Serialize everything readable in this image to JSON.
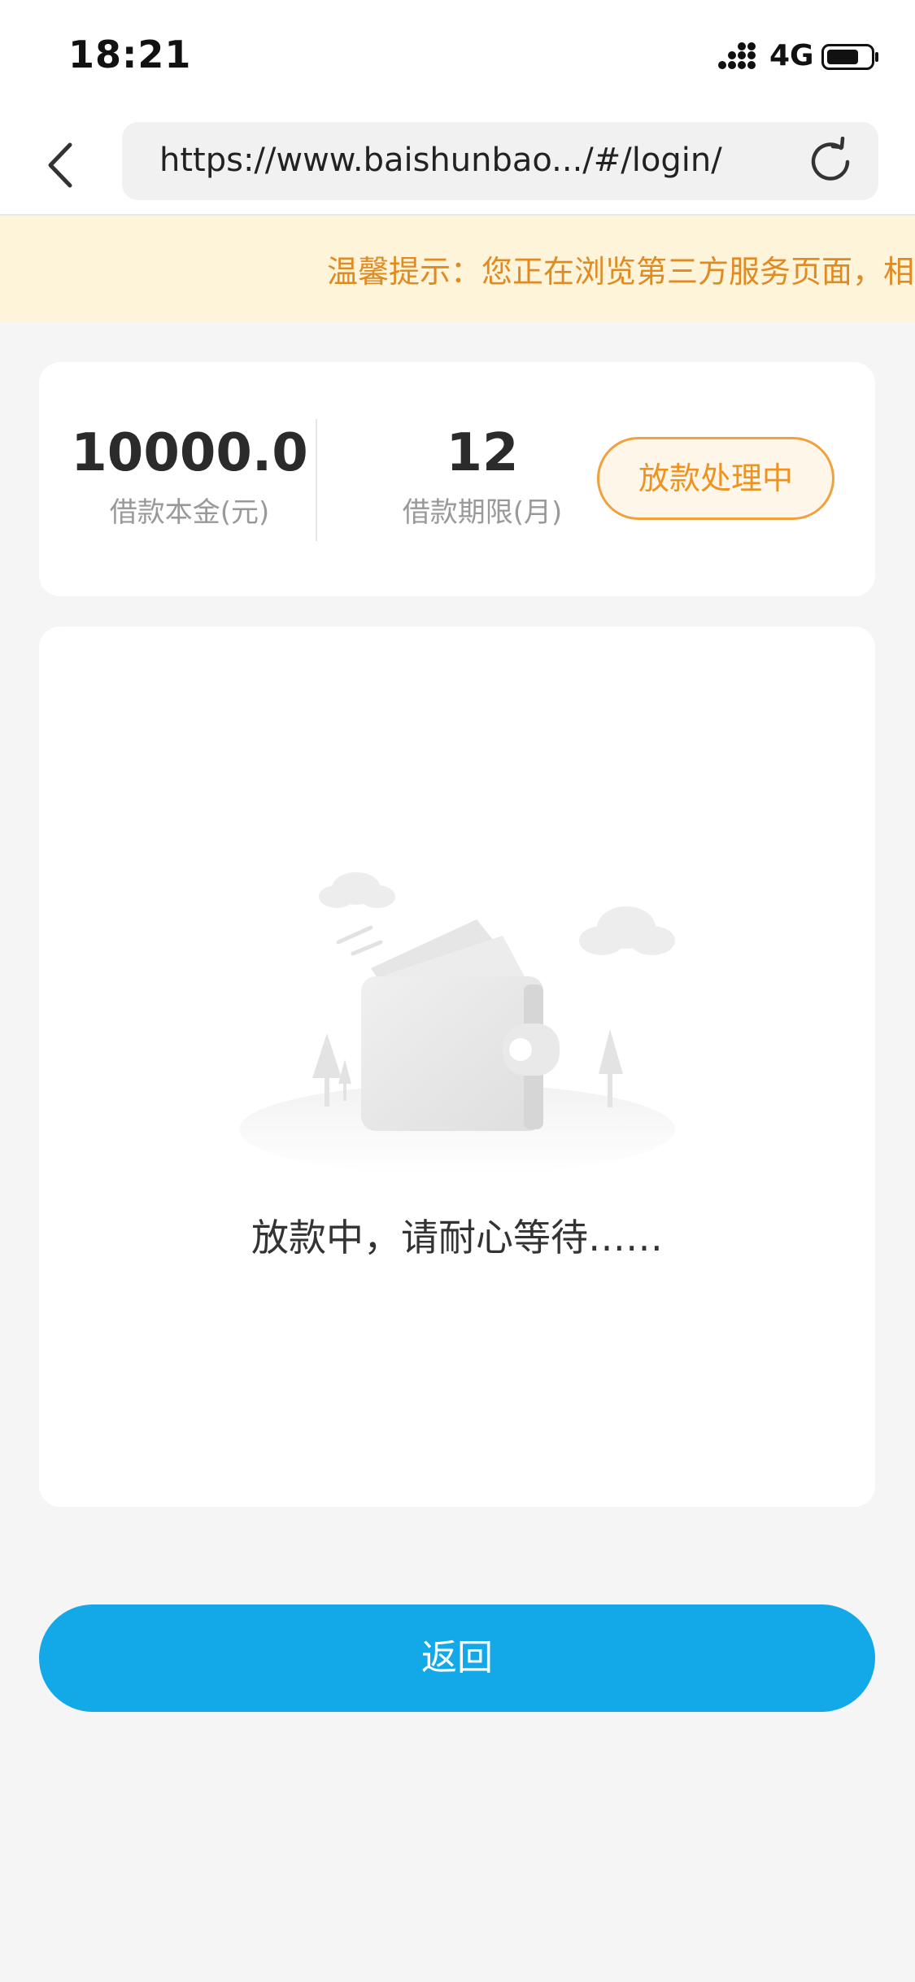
{
  "status_bar": {
    "time": "18:21",
    "network": "4G"
  },
  "browser": {
    "url": "https://www.baishunbao.../#/login/",
    "back_icon": "chevron-left-icon",
    "reload_icon": "reload-icon"
  },
  "notice": {
    "text": "温馨提示：您正在浏览第三方服务页面，相"
  },
  "loan_summary": {
    "amount": "10000.0",
    "amount_label": "借款本金(元)",
    "term": "12",
    "term_label": "借款期限(月)",
    "status": "放款处理中"
  },
  "wait_panel": {
    "illustration": "wallet-icon",
    "message": "放款中，请耐心等待……"
  },
  "actions": {
    "return_label": "返回"
  },
  "colors": {
    "accent_orange": "#ee9320",
    "notice_bg": "#fef4d9",
    "primary_blue": "#13a8e8"
  }
}
